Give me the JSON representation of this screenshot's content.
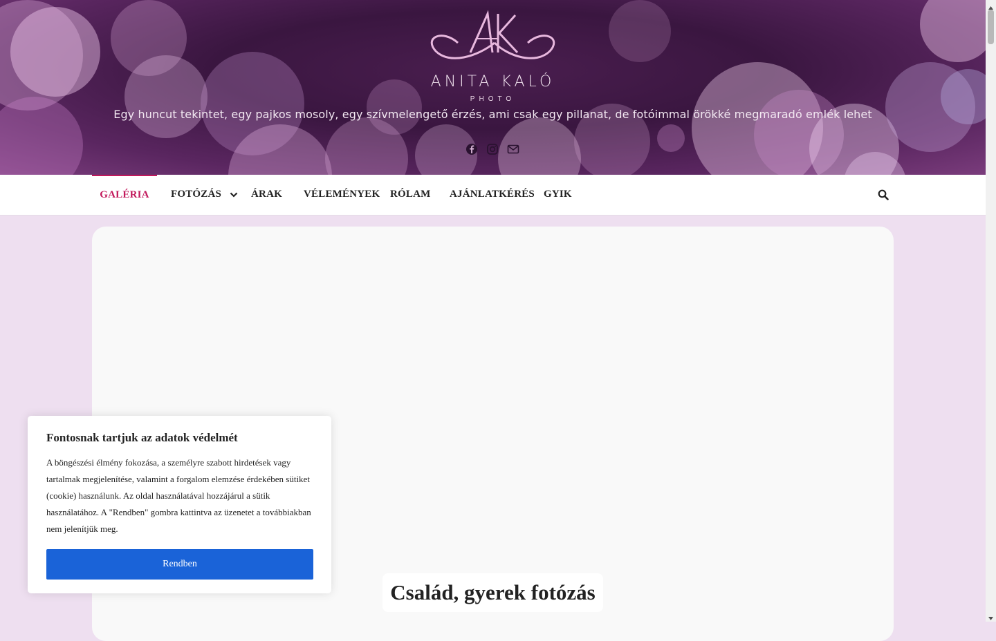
{
  "header": {
    "logo_mark": "AK",
    "logo_name": "ANITA KALÓ",
    "logo_sub": "PHOTO",
    "tagline": "Egy huncut tekintet, egy pajkos mosoly, egy szívmelengető érzés, ami csak egy pillanat, de fotóimmal örökké megmaradó emlék lehet",
    "socials": [
      "facebook-icon",
      "instagram-icon",
      "envelope-icon"
    ]
  },
  "nav": {
    "items": [
      {
        "label": "GALÉRIA",
        "active": true
      },
      {
        "label": "FOTÓZÁS",
        "has_dropdown": true
      },
      {
        "label": "ÁRAK"
      },
      {
        "label": "VÉLEMÉNYEK"
      },
      {
        "label": "RÓLAM"
      },
      {
        "label": "AJÁNLATKÉRÉS"
      },
      {
        "label": "GYIK"
      }
    ],
    "search_icon": "search-icon"
  },
  "main": {
    "title": "Család, gyerek fotózás"
  },
  "cookie": {
    "title": "Fontosnak tartjuk az adatok védelmét",
    "text": "A böngészési élmény fokozása, a személyre szabott hirdetések vagy tartalmak megjelenítése, valamint a forgalom elemzése érdekében sütiket (cookie) használunk. Az oldal használatával hozzájárul a sütik használatához. A \"Rendben\" gombra kattintva az üzenetet a továbbiakban nem jelenítjük meg.",
    "button": "Rendben"
  },
  "colors": {
    "accent": "#c2185b",
    "button": "#1a63d8",
    "page_bg": "#eedff0",
    "header_bg": "#3a1640"
  }
}
